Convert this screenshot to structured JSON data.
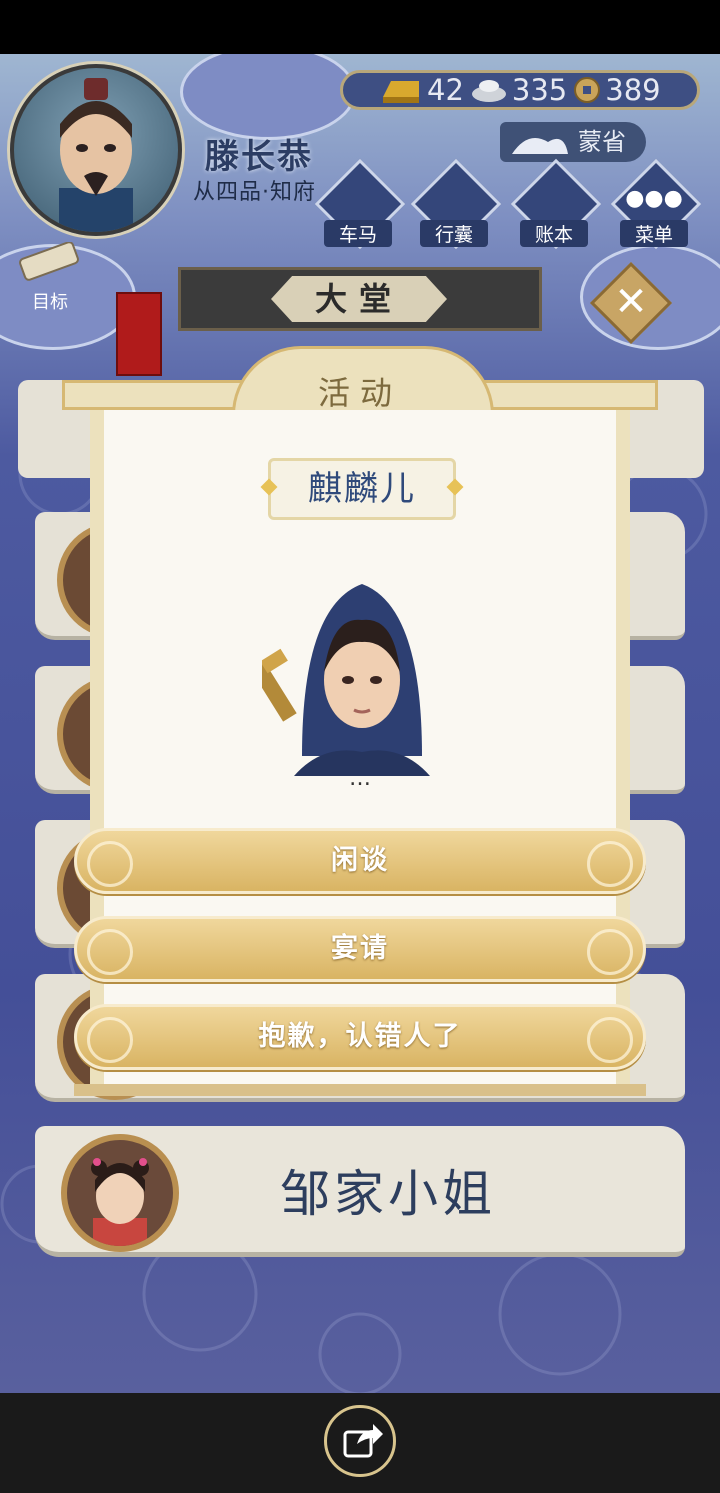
{
  "player": {
    "name": "滕长恭",
    "rank": "从四品·知府"
  },
  "currency": {
    "gold": "42",
    "silver": "335",
    "coin": "389"
  },
  "region": "蒙省",
  "menu": [
    {
      "label": "车马",
      "icon": "carriage-icon"
    },
    {
      "label": "行囊",
      "icon": "bag-icon"
    },
    {
      "label": "账本",
      "icon": "ledger-icon"
    },
    {
      "label": "菜单",
      "icon": "more-icon"
    }
  ],
  "goal_label": "目标",
  "hall_title": "大堂",
  "dialog": {
    "title": "活动",
    "npc_name": "麒麟儿",
    "line": "…",
    "options": [
      "闲谈",
      "宴请",
      "抱歉，认错人了"
    ]
  },
  "list_card_name": "邹家小姐",
  "colors": {
    "accent_gold": "#d9b463",
    "navy": "#444f98",
    "cream": "#faf8f2"
  }
}
